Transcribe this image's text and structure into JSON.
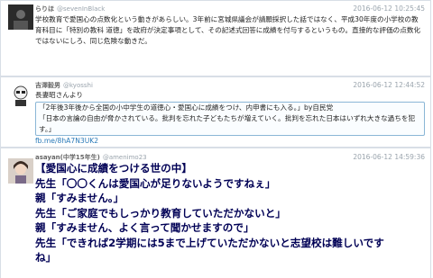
{
  "tweets": [
    {
      "name": "らりほ",
      "handle": "@sevenInBlack",
      "time": "2016-06-12 10:25:45",
      "text": "学校教育で愛国心の点数化という動きがあらしい。3年前に宮城県議会が請願採択した話ではなく、平成30年度の小学校の教育科目に「特別の教科 道徳」を政府が決定事項として、その記述式回答に成績を付与するというもの。直接的な評価の点数化ではないにしろ、同じ危険な動きだ。"
    },
    {
      "name": "吉澤毅男",
      "handle": "@kyosshi",
      "time": "2016-06-12 12:44:52",
      "text": "長妻昭さんより",
      "quote": [
        "「2年後3年後から全国の小中学生の道徳心・愛国心に成績をつけ、内申書にも入る。」by自民党",
        "「日本の言論の自由が脅かされている。批判を忘れた子どもたちが増えていく。批判を忘れた日本はいずれ大きな過ちを犯す。」"
      ],
      "link": "fb.me/8hA7N3UK2"
    },
    {
      "name": "asayan(中学15年生)",
      "handle": "@amenimo23",
      "time": "2016-06-12 14:59:36",
      "lines": [
        "【愛国心に成績をつける世の中】",
        "先生「〇〇くんは愛国心が足りないようですねぇ」",
        "親「すみません。」",
        "先生「ご家庭でもしっかり教育していただかないと」",
        "親「すみません、よく言って聞かせますので」",
        "先生「できれば2学期には5まで上げていただかないと志望校は難しいです",
        "ね」"
      ]
    }
  ]
}
